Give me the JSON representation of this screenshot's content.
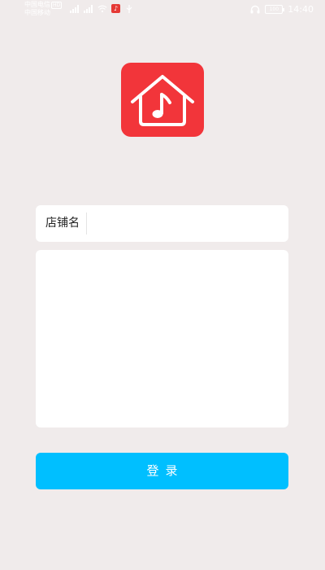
{
  "status_bar": {
    "carrier_1": "中国电信",
    "carrier_1_badge": "HD",
    "carrier_2": "中国移动",
    "signal_1": "4G",
    "signal_2": "4G",
    "battery": "100",
    "time": "14:40"
  },
  "logo": {
    "icon": "house-music-note-icon",
    "color": "#f2353a"
  },
  "form": {
    "shop_label": "店铺名",
    "shop_value": "",
    "shop_placeholder": ""
  },
  "login_button": {
    "label": "登录",
    "color": "#00bfff"
  }
}
